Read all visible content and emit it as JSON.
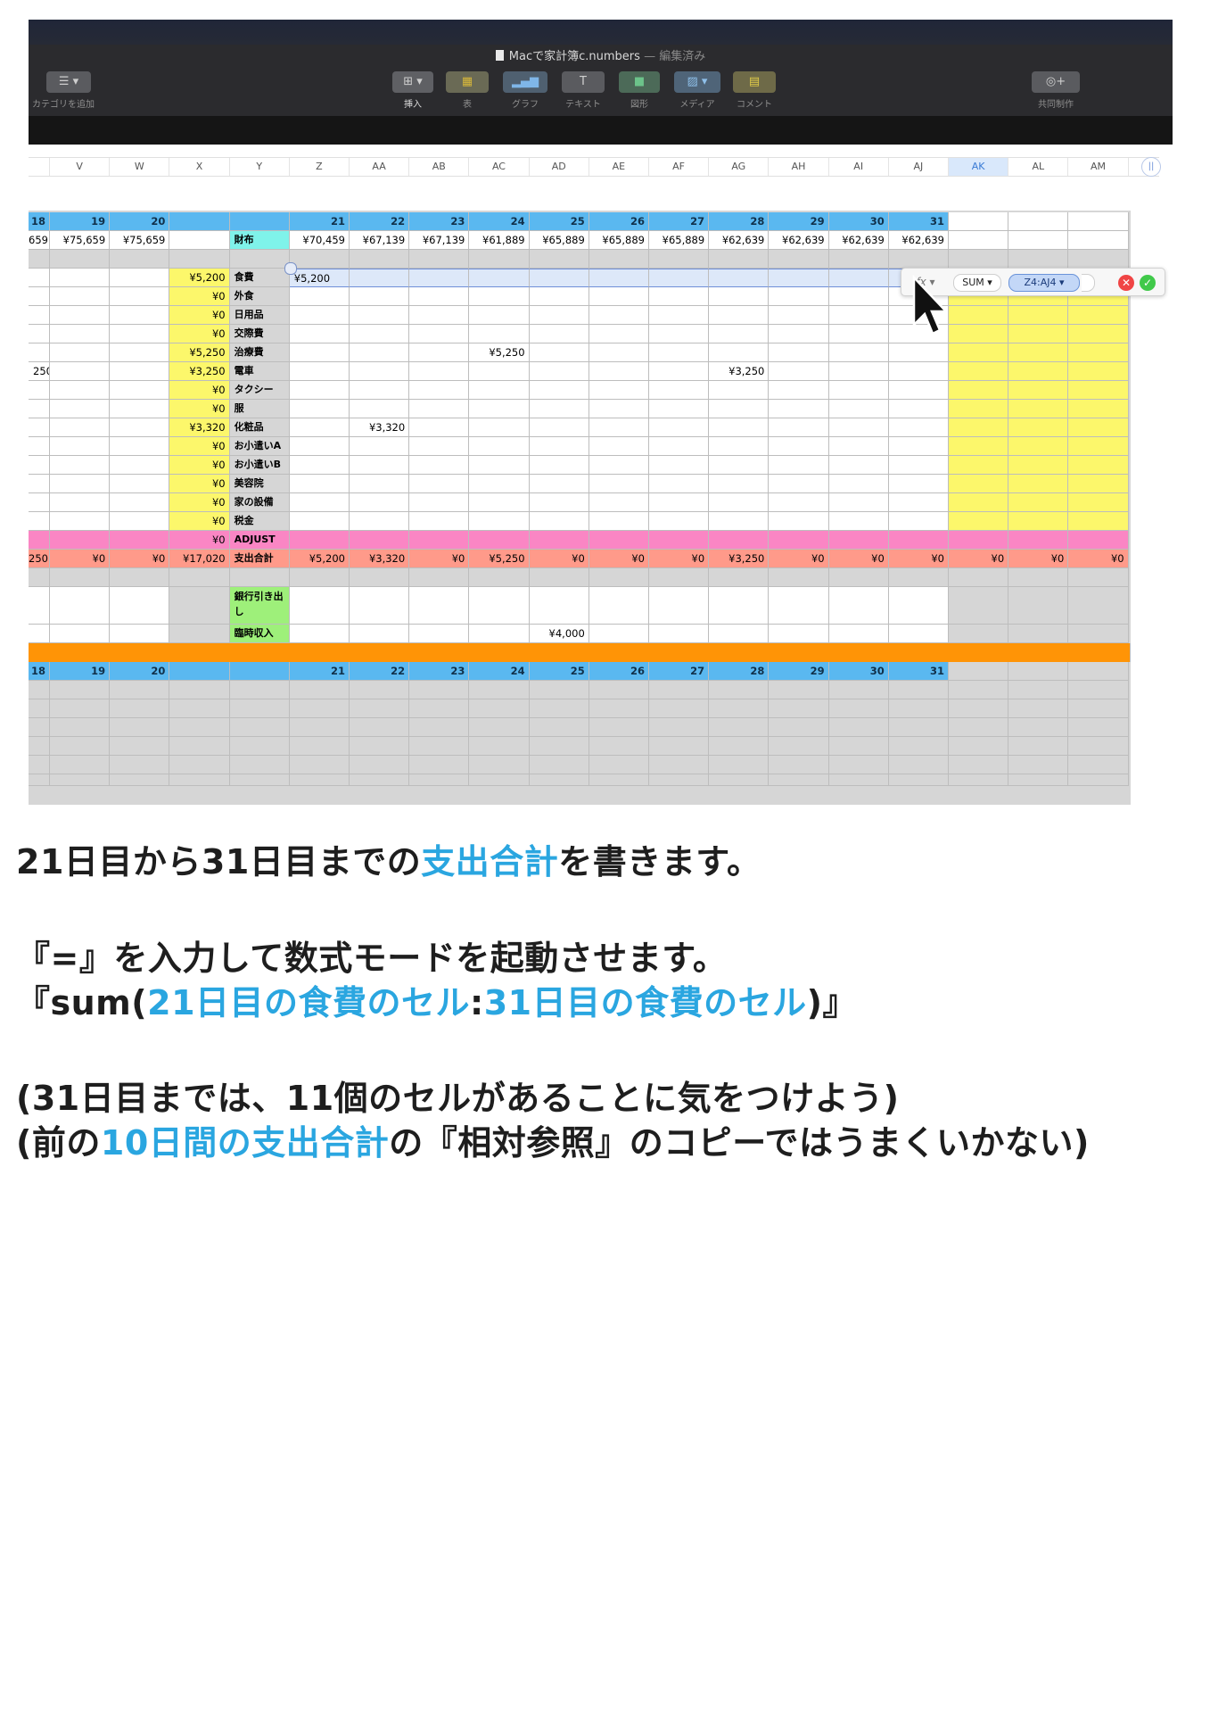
{
  "window": {
    "title": "Macで家計簿c.numbers",
    "title_status": "— 編集済み",
    "toolbar": {
      "category_label": "カテゴリを追加",
      "insert_label": "挿入",
      "table_label": "表",
      "chart_label": "グラフ",
      "text_label": "テキスト",
      "shape_label": "図形",
      "media_label": "メディア",
      "comment_label": "コメント",
      "collab_label": "共同制作"
    }
  },
  "columns": [
    "V",
    "W",
    "X",
    "Y",
    "Z",
    "AA",
    "AB",
    "AC",
    "AD",
    "AE",
    "AF",
    "AG",
    "AH",
    "AI",
    "AJ",
    "AK",
    "AL",
    "AM"
  ],
  "selected_column": "AK",
  "sheet": {
    "days_left": [
      "18",
      "19",
      "20"
    ],
    "days_right": [
      "21",
      "22",
      "23",
      "24",
      "25",
      "26",
      "27",
      "28",
      "29",
      "30",
      "31"
    ],
    "wallet": {
      "label": "財布",
      "left": [
        "659",
        "¥75,659",
        "¥75,659"
      ],
      "right": [
        "¥70,459",
        "¥67,139",
        "¥67,139",
        "¥61,889",
        "¥65,889",
        "¥65,889",
        "¥65,889",
        "¥62,639",
        "¥62,639",
        "¥62,639",
        "¥62,639"
      ]
    },
    "categories": [
      {
        "label": "食費",
        "total": "¥5,200"
      },
      {
        "label": "外食",
        "total": "¥0"
      },
      {
        "label": "日用品",
        "total": "¥0"
      },
      {
        "label": "交際費",
        "total": "¥0"
      },
      {
        "label": "治療費",
        "total": "¥5,250"
      },
      {
        "label": "電車",
        "total": "¥3,250"
      },
      {
        "label": "タクシー",
        "total": "¥0"
      },
      {
        "label": "服",
        "total": "¥0"
      },
      {
        "label": "化粧品",
        "total": "¥3,320"
      },
      {
        "label": "お小遣いA",
        "total": "¥0"
      },
      {
        "label": "お小遣いB",
        "total": "¥0"
      },
      {
        "label": "美容院",
        "total": "¥0"
      },
      {
        "label": "家の設備",
        "total": "¥0"
      },
      {
        "label": "税金",
        "total": "¥0"
      }
    ],
    "row_fragment_left": "250",
    "food_z": "¥5,200",
    "ac_treatment": "¥5,250",
    "ag_train": "¥3,250",
    "aa_cosmetics": "¥3,320",
    "adjust": {
      "label": "ADJUST",
      "total": "¥0"
    },
    "expense": {
      "label": "支出合計",
      "left": [
        "250",
        "¥0",
        "¥0"
      ],
      "total": "¥17,020",
      "right": [
        "¥5,200",
        "¥3,320",
        "¥0",
        "¥5,250",
        "¥0",
        "¥0",
        "¥0",
        "¥3,250",
        "¥0",
        "¥0",
        "¥0",
        "¥0",
        "¥0",
        "¥0"
      ]
    },
    "bank_label": "銀行引き出し",
    "temp_income_label": "臨時収入",
    "temp_income_ad": "¥4,000"
  },
  "formula": {
    "fx": "fx ▾",
    "func": "SUM ▾",
    "ref": "Z4:AJ4 ▾",
    "cancel": "✕",
    "ok": "✓"
  },
  "text": {
    "line1_a": "21日目から31日目までの",
    "line1_b": "支出合計",
    "line1_c": "を書きます。",
    "line2": "『=』を入力して数式モードを起動させます。",
    "line3_a": "『sum(",
    "line3_b": "21日目の食費のセル",
    "line3_c": ":",
    "line3_d": "31日目の食費のセル",
    "line3_e": ")』",
    "line4": "(31日目までは、11個のセルがあることに気をつけよう)",
    "line5_a": "(前の",
    "line5_b": "10日間の支出合計",
    "line5_c": "の『相対参照』のコピーではうまくいかない)"
  },
  "colors": {
    "day_header": "#5ab8f0",
    "highlight_text": "#2aa6e0",
    "summary_yellow": "#fcf76b",
    "adjust_pink": "#fa86c4",
    "expense_salmon": "#ff9a8a",
    "orange_bar": "#ff9406"
  }
}
